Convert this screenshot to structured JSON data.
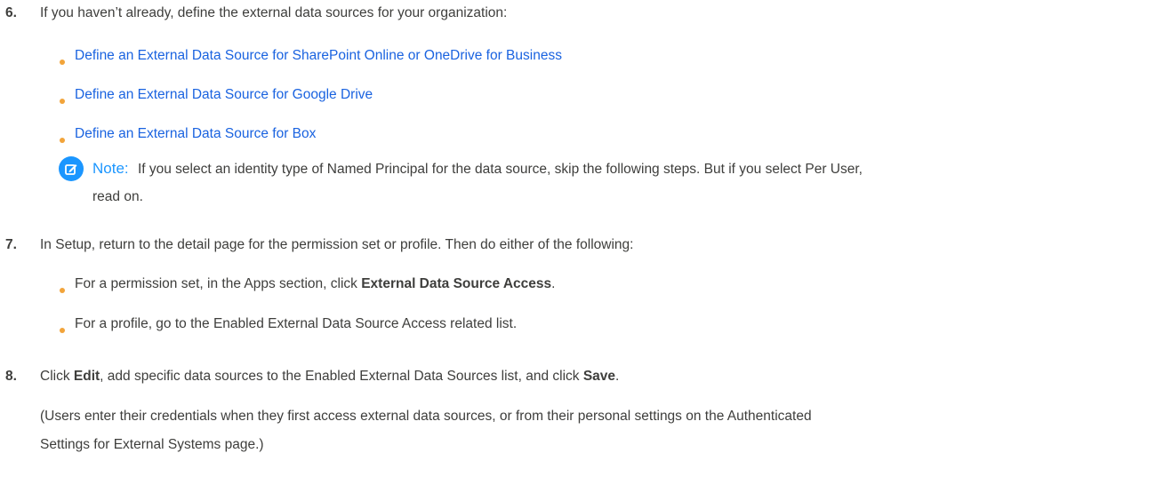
{
  "steps": [
    {
      "num": "6.",
      "text": "If you haven’t already, define the external data sources for your organization:"
    },
    {
      "num": "7.",
      "text": "In Setup, return to the detail page for the permission set or profile. Then do either of the following:"
    },
    {
      "num": "8.",
      "pre": "Click ",
      "edit": "Edit",
      "mid": ", add specific data sources to the Enabled External Data Sources list, and click ",
      "save": "Save",
      "end": "."
    }
  ],
  "links": [
    "Define an External Data Source for SharePoint Online or OneDrive for Business",
    "Define an External Data Source for Google Drive",
    "Define an External Data Source for Box"
  ],
  "note": {
    "label": "Note:",
    "line1": "If you select an identity type of Named Principal for the data source, skip the following steps. But if you select Per User,",
    "line2": "read on."
  },
  "step7_bullets": [
    {
      "pre": "For a permission set, in the Apps section, click ",
      "bold": "External Data Source Access",
      "post": "."
    },
    {
      "text": "For a profile, go to the Enabled External Data Source Access related list."
    }
  ],
  "step8_para": {
    "line1": "(Users enter their credentials when they first access external data sources, or from their personal settings on the Authenticated",
    "line2": "Settings for External Systems page.)"
  },
  "colors": {
    "link": "#1a63e0",
    "bullet": "#f2a43a",
    "note_accent": "#1b96ff",
    "text": "#3e3e3c"
  }
}
